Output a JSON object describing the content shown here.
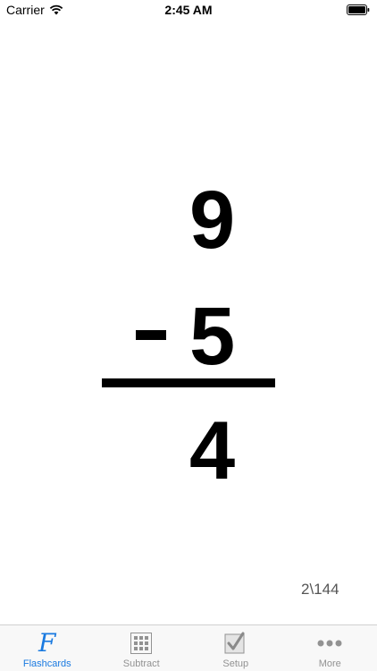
{
  "status_bar": {
    "carrier": "Carrier",
    "time": "2:45 AM",
    "wifi_icon": "wifi-icon",
    "battery_icon": "battery-icon"
  },
  "flashcard": {
    "top_number": "9",
    "operator": "-",
    "bottom_number": "5",
    "answer": "4",
    "progress": "2\\144"
  },
  "tab_bar": {
    "active_color": "#1a7ae0",
    "inactive_color": "#929292",
    "tabs": [
      {
        "label": "Flashcards",
        "icon": "flashcards-icon",
        "active": true
      },
      {
        "label": "Subtract",
        "icon": "grid-icon",
        "active": false
      },
      {
        "label": "Setup",
        "icon": "checkbox-icon",
        "active": false
      },
      {
        "label": "More",
        "icon": "more-icon",
        "active": false
      }
    ]
  }
}
